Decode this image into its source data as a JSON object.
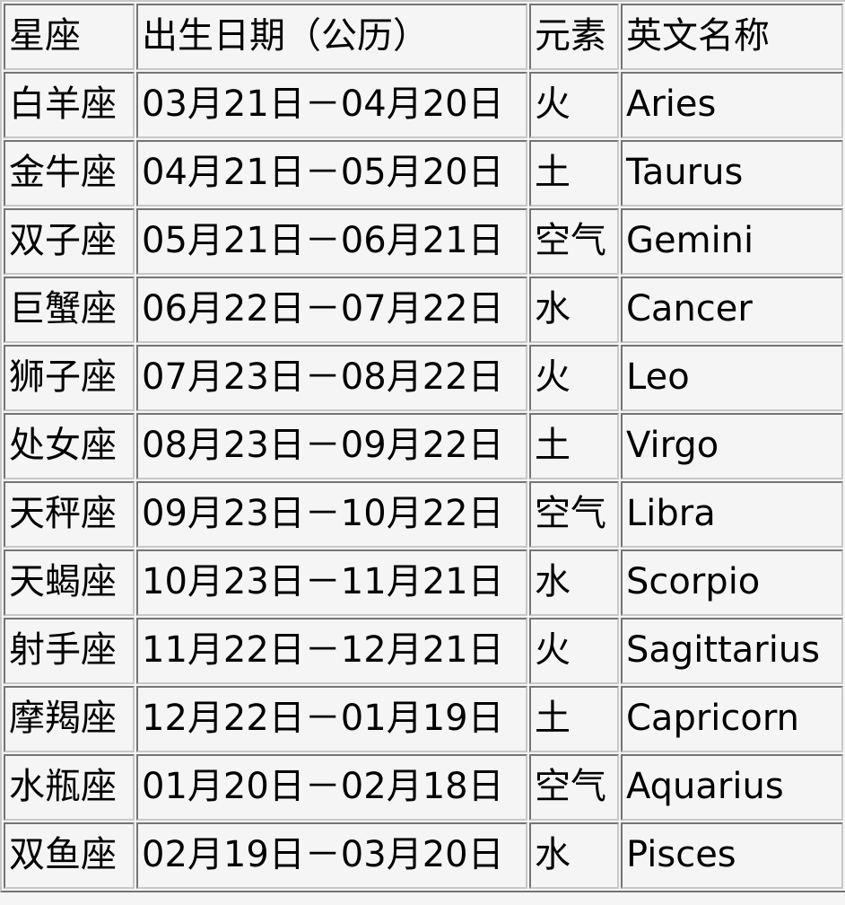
{
  "table": {
    "name": "zodiac-signs-table",
    "headers": [
      "星座",
      "出生日期（公历）",
      "元素",
      "英文名称"
    ],
    "rows": [
      {
        "sign": "白羊座",
        "dates": "03月21日－04月20日",
        "element": "火",
        "english": "Aries"
      },
      {
        "sign": "金牛座",
        "dates": "04月21日－05月20日",
        "element": "土",
        "english": "Taurus"
      },
      {
        "sign": "双子座",
        "dates": "05月21日－06月21日",
        "element": "空气",
        "english": "Gemini"
      },
      {
        "sign": "巨蟹座",
        "dates": "06月22日－07月22日",
        "element": "水",
        "english": "Cancer"
      },
      {
        "sign": "狮子座",
        "dates": "07月23日－08月22日",
        "element": "火",
        "english": "Leo"
      },
      {
        "sign": "处女座",
        "dates": "08月23日－09月22日",
        "element": "土",
        "english": "Virgo"
      },
      {
        "sign": "天秤座",
        "dates": "09月23日－10月22日",
        "element": "空气",
        "english": "Libra"
      },
      {
        "sign": "天蝎座",
        "dates": "10月23日－11月21日",
        "element": "水",
        "english": "Scorpio"
      },
      {
        "sign": "射手座",
        "dates": "11月22日－12月21日",
        "element": "火",
        "english": "Sagittarius"
      },
      {
        "sign": "摩羯座",
        "dates": "12月22日－01月19日",
        "element": "土",
        "english": "Capricorn"
      },
      {
        "sign": "水瓶座",
        "dates": "01月20日－02月18日",
        "element": "空气",
        "english": "Aquarius"
      },
      {
        "sign": "双鱼座",
        "dates": "02月19日－03月20日",
        "element": "水",
        "english": "Pisces"
      }
    ]
  },
  "colors": {
    "page_background": "#f5f5f5",
    "cell_background": "#f5f5f5",
    "text": "#000000",
    "border_dark": "#2b2b2b",
    "border_light": "#c8c8c8"
  }
}
